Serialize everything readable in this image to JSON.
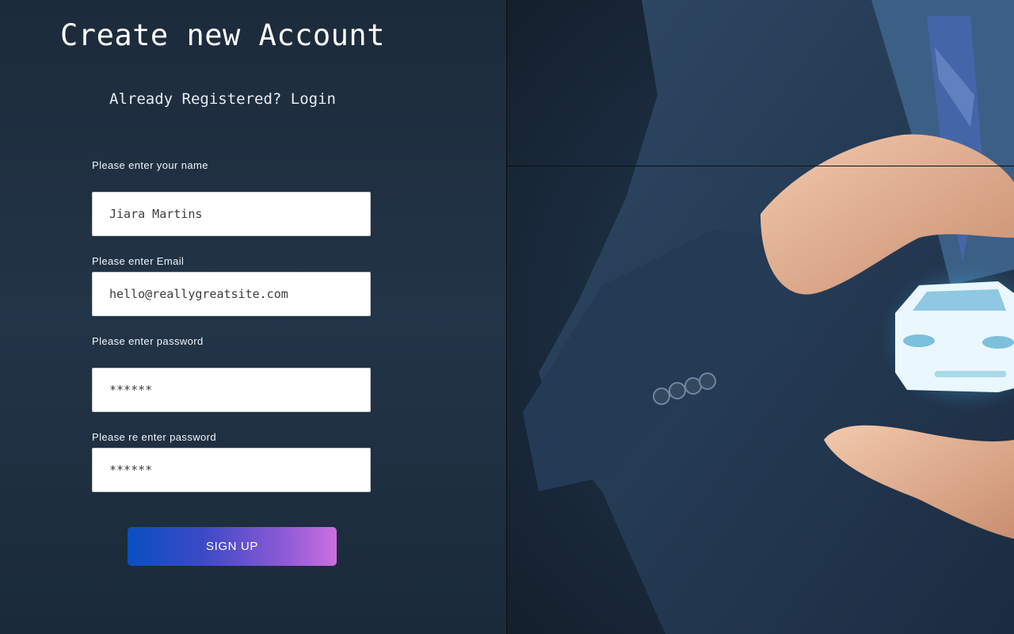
{
  "form": {
    "title": "Create new Account",
    "subtitle_prefix": "Already Registered?",
    "login_link": "Login",
    "name_label": "Please enter your name",
    "name_value": "Jiara Martins",
    "email_label": "Please enter Email",
    "email_value": "hello@reallygreatsite.com",
    "password_label": "Please enter password",
    "password_value": "******",
    "repassword_label": "Please re enter password",
    "repassword_value": "******",
    "signup_label": "SIGN UP"
  },
  "colors": {
    "button_gradient_start": "#0a4fc0",
    "button_gradient_end": "#cc6fe0",
    "background": "#1f2e3f"
  },
  "photo": {
    "icon": "car-insurance-hands-icon"
  }
}
